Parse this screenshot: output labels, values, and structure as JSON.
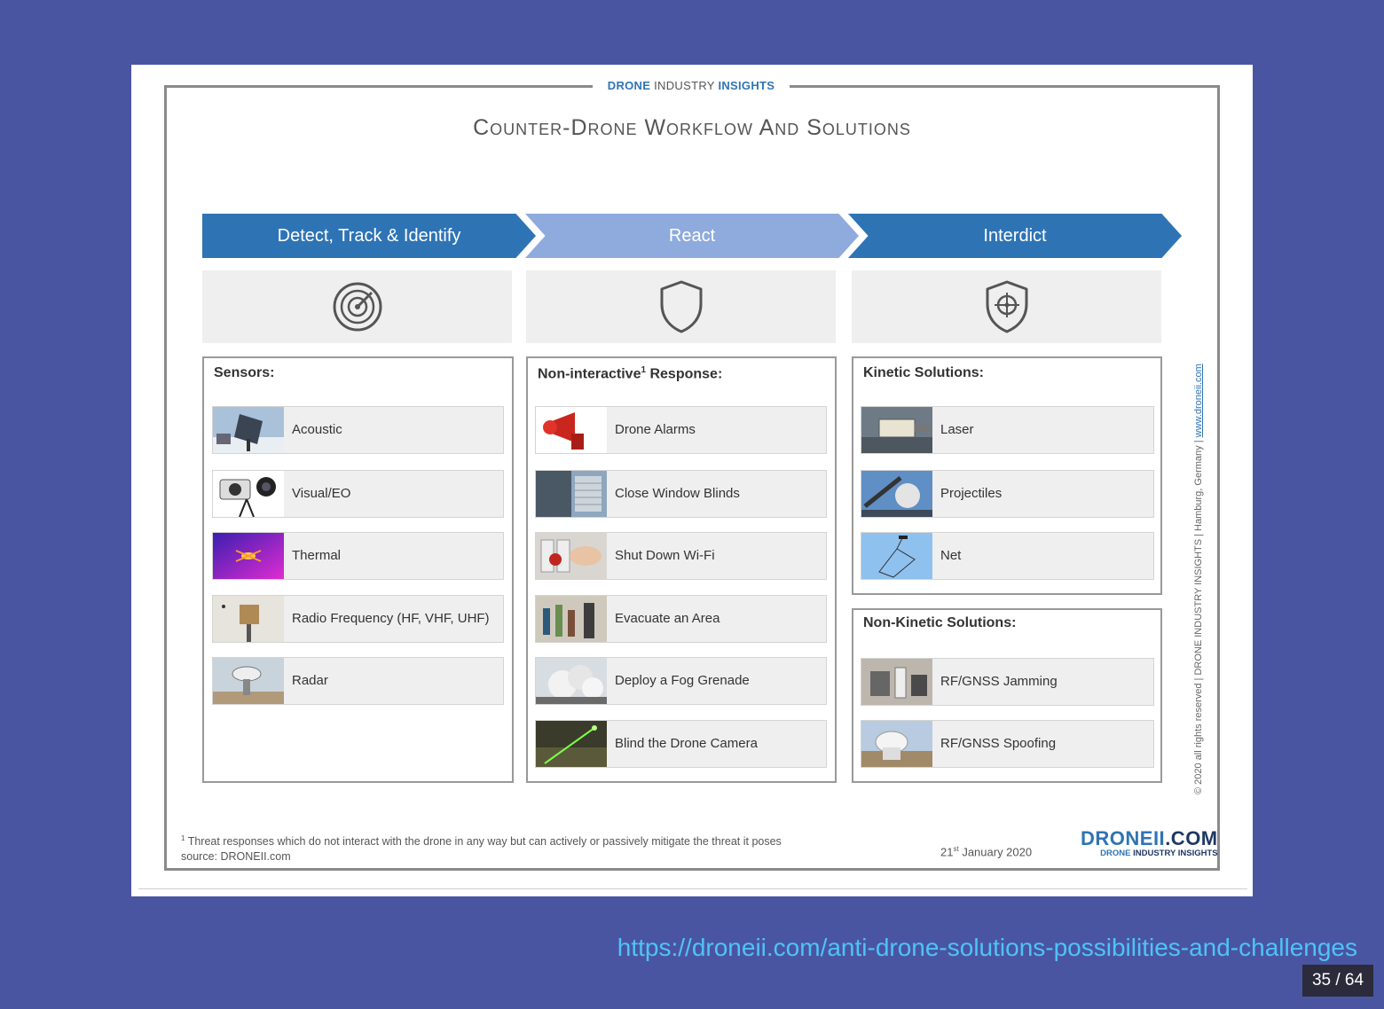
{
  "slide": {
    "brand_header": {
      "part1": "DRONE",
      "part2": "INDUSTRY",
      "part3": "INSIGHTS"
    },
    "title": "Counter-Drone  Workflow And Solutions",
    "stages": [
      {
        "label": "Detect, Track & Identify",
        "icon": "radar-icon"
      },
      {
        "label": "React",
        "icon": "shield-icon"
      },
      {
        "label": "Interdict",
        "icon": "crosshair-shield-icon"
      }
    ],
    "sensors": {
      "heading": "Sensors:",
      "items": [
        "Acoustic",
        "Visual/EO",
        "Thermal",
        "Radio Frequency (HF, VHF,  UHF)",
        "Radar"
      ]
    },
    "response": {
      "heading_pre": "Non-interactive",
      "heading_sup": "1",
      "heading_post": " Response:",
      "items": [
        "Drone Alarms",
        "Close Window Blinds",
        "Shut Down Wi-Fi",
        "Evacuate an Area",
        "Deploy a Fog Grenade",
        "Blind the Drone Camera"
      ]
    },
    "kinetic": {
      "heading": "Kinetic Solutions:",
      "items": [
        "Laser",
        "Projectiles",
        "Net"
      ]
    },
    "non_kinetic": {
      "heading": "Non-Kinetic  Solutions:",
      "items": [
        "RF/GNSS Jamming",
        "RF/GNSS Spoofing"
      ]
    },
    "side_text": "© 2020 all rights reserved | DRONE INDUSTRY INSIGHTS | Hamburg, Germany | ",
    "side_link": "www.droneii.com",
    "footnote_sup": "1",
    "footnote_line1": " Threat responses which do not interact with the drone in  any way but can actively or passively mitigate the threat it poses",
    "footnote_line2": "source: DRONEII.com",
    "date_day": "21",
    "date_sup": "st",
    "date_rest": " January 2020",
    "logo": {
      "main": "DRONEII",
      "com": ".COM",
      "sub1": "DRONE",
      "sub2": " INDUSTRY INSIGHTS"
    }
  },
  "source_url": "https://droneii.com/anti-drone-solutions-possibilities-and-challenges",
  "pager": "35 / 64",
  "colors": {
    "background": "#4a55a2",
    "accent_blue": "#2e74b5",
    "light_blue": "#8faadc",
    "link": "#4fc3f7"
  }
}
